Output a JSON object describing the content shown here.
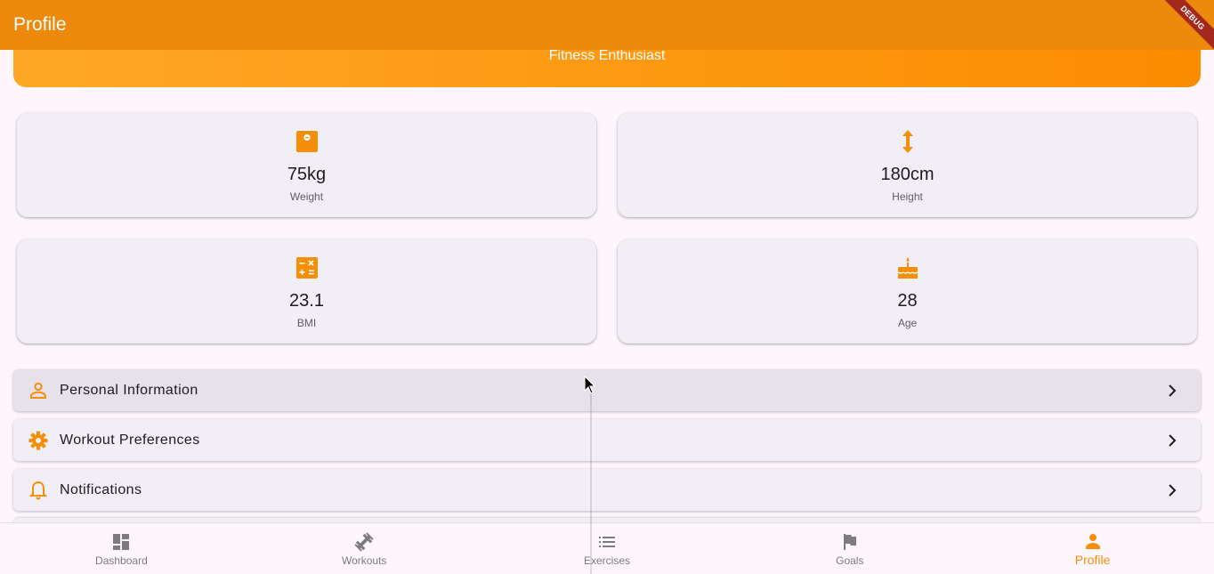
{
  "appbar": {
    "title": "Profile",
    "debug_label": "DEBUG"
  },
  "header": {
    "subtitle": "Fitness Enthusiast"
  },
  "stats": [
    {
      "icon": "scale-icon",
      "value": "75kg",
      "label": "Weight"
    },
    {
      "icon": "height-icon",
      "value": "180cm",
      "label": "Height"
    },
    {
      "icon": "calculator-icon",
      "value": "23.1",
      "label": "BMI"
    },
    {
      "icon": "cake-icon",
      "value": "28",
      "label": "Age"
    }
  ],
  "menu": [
    {
      "icon": "person-outline-icon",
      "label": "Personal Information"
    },
    {
      "icon": "gear-icon",
      "label": "Workout Preferences"
    },
    {
      "icon": "bell-icon",
      "label": "Notifications"
    }
  ],
  "nav": [
    {
      "icon": "dashboard-icon",
      "label": "Dashboard",
      "active": false
    },
    {
      "icon": "dumbbell-icon",
      "label": "Workouts",
      "active": false
    },
    {
      "icon": "list-icon",
      "label": "Exercises",
      "active": false
    },
    {
      "icon": "flag-icon",
      "label": "Goals",
      "active": false
    },
    {
      "icon": "person-icon",
      "label": "Profile",
      "active": true
    }
  ],
  "colors": {
    "accent": "#F58F0A",
    "appbar": "#EC8A0C",
    "card_bg": "#F2EEF5",
    "inactive": "#7D7A80"
  }
}
